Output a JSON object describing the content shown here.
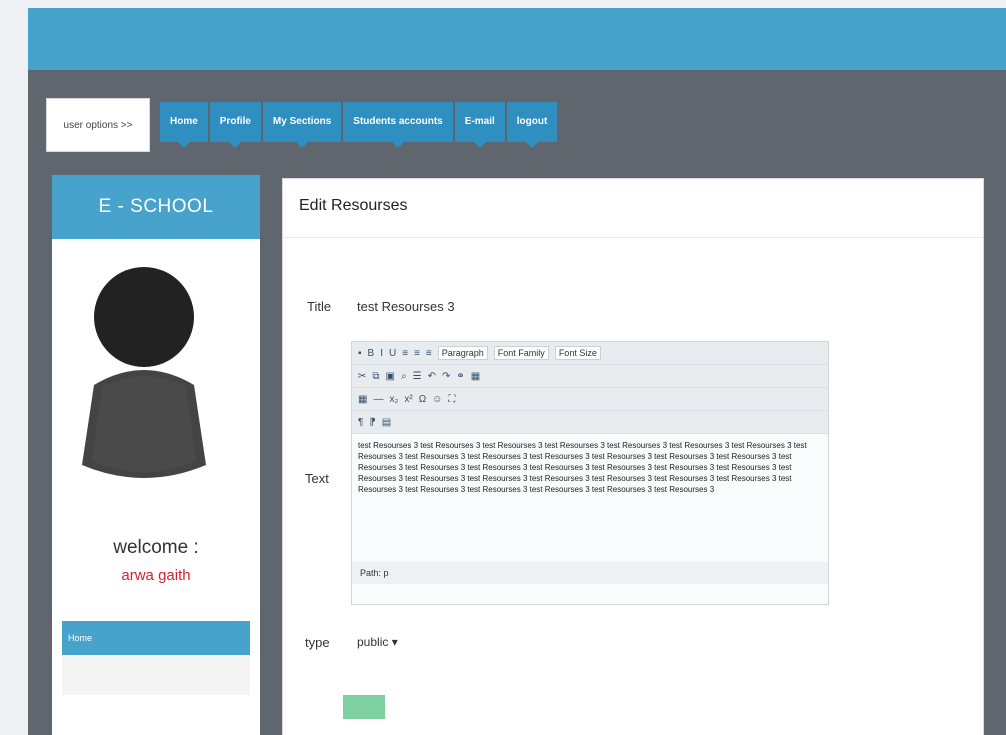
{
  "nav": {
    "user_options": "user options >>",
    "tabs": [
      "Home",
      "Profile",
      "My Sections",
      "Students accounts",
      "E-mail",
      "logout"
    ]
  },
  "sidebar": {
    "title": "E - SCHOOL",
    "welcome": "welcome :",
    "username": "arwa gaith",
    "menu_item": "Home"
  },
  "form": {
    "heading": "Edit Resourses",
    "title_label": "Title",
    "title_value": "test Resourses 3",
    "text_label": "Text",
    "toolbar": {
      "paragraph": "Paragraph",
      "font_family": "Font Family",
      "font_size": "Font Size"
    },
    "text_value": "test Resourses 3 test Resourses 3 test Resourses 3 test Resourses 3 test Resourses 3 test Resourses 3 test Resourses 3 test Resourses 3 test Resourses 3 test Resourses 3 test Resourses 3 test Resourses 3 test Resourses 3 test Resourses 3 test Resourses 3 test Resourses 3 test Resourses 3 test Resourses 3 test Resourses 3 test Resourses 3 test Resourses 3 test Resourses 3 test Resourses 3 test Resourses 3 test Resourses 3 test Resourses 3 test Resourses 3 test Resourses 3 test Resourses 3 test Resourses 3 test Resourses 3 test Resourses 3 test Resourses 3 test Resourses 3",
    "path": "Path: p",
    "type_label": "type",
    "type_value": "public"
  },
  "colors": {
    "accent": "#47a3cc",
    "tab": "#2f8fc0",
    "username": "#d6222f",
    "save": "#7fd0a0"
  }
}
